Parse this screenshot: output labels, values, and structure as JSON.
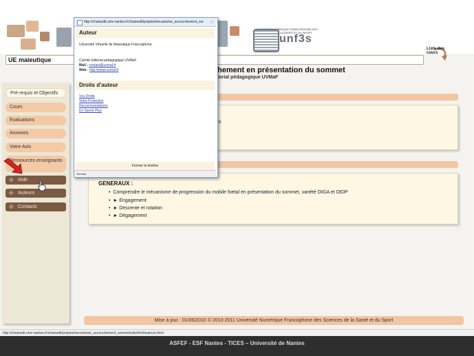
{
  "header": {
    "logo_text": "unf3s",
    "logo_small": "UNIVERSITÉ NUMÉRIQUE FRANCOPHONE DES SCIENCES DE LA SANTÉ ET DU SPORT",
    "liste_label": "Liste des cours"
  },
  "course": {
    "label": "UE maieutique"
  },
  "main": {
    "title": "hement en présentation du sommet",
    "subtitle": "torial pédagogique UVMaF",
    "partial_text": "es"
  },
  "sidebar": {
    "items": [
      {
        "label": "Pré-requis et Objectifs"
      },
      {
        "label": "Cours"
      },
      {
        "label": "Evaluations"
      },
      {
        "label": "Annexes"
      },
      {
        "label": "Votre Avis"
      },
      {
        "label": "Ressources enseignants"
      }
    ],
    "dark_items": [
      {
        "label": "Aide"
      },
      {
        "label": "Auteurs"
      },
      {
        "label": "Contacts"
      }
    ]
  },
  "general": {
    "title": "GENERAUX :",
    "bullets": [
      "Comprendre le mécanisme de progression du mobile foetal en présentation du sommet, variété OIGA et OIDP",
      "► Engagement",
      "► Descente et rotation",
      "► Dégagement"
    ]
  },
  "footer": {
    "text": "Mise à jour : 01/06/2010 © 2010-2011 Université Numérique Francophone des Sciences de la Santé et du Sport"
  },
  "statusbar": {
    "url": "http://chainedit.univ-nantes.fr/chainedit/projets/mecanisme_accouchement_sommet/site/html/auteurs.html"
  },
  "caption": {
    "text": "ASFEF - ESF Nantes - TICES – Université de Nantes"
  },
  "popup": {
    "url": "http://chainedit.univ-nantes.fr/chainedit/projets/mecanisme_accouchement_sor",
    "author_heading": "Auteur",
    "author_name": "Université Virtuelle de Maïeutique Francophone",
    "committee": "Comité éditorial pédagogique UVMaF",
    "mail_label": "Mail :",
    "mail_value": "contact@uvmaf.fr",
    "web_label": "Web :",
    "web_value": "http://www.uvmaf.fr",
    "rights_heading": "Droits d'auteur",
    "links": [
      "Vos Droits",
      "Votre Protection",
      "Recommandations",
      "En Savoir Plus"
    ],
    "close_label": "Fermer la fenêtre",
    "status": "Terminé"
  },
  "colors": {
    "accent": "#f2c5a3",
    "sidebar_dark": "#7a5a43",
    "box_bg": "#fdf7e4"
  }
}
